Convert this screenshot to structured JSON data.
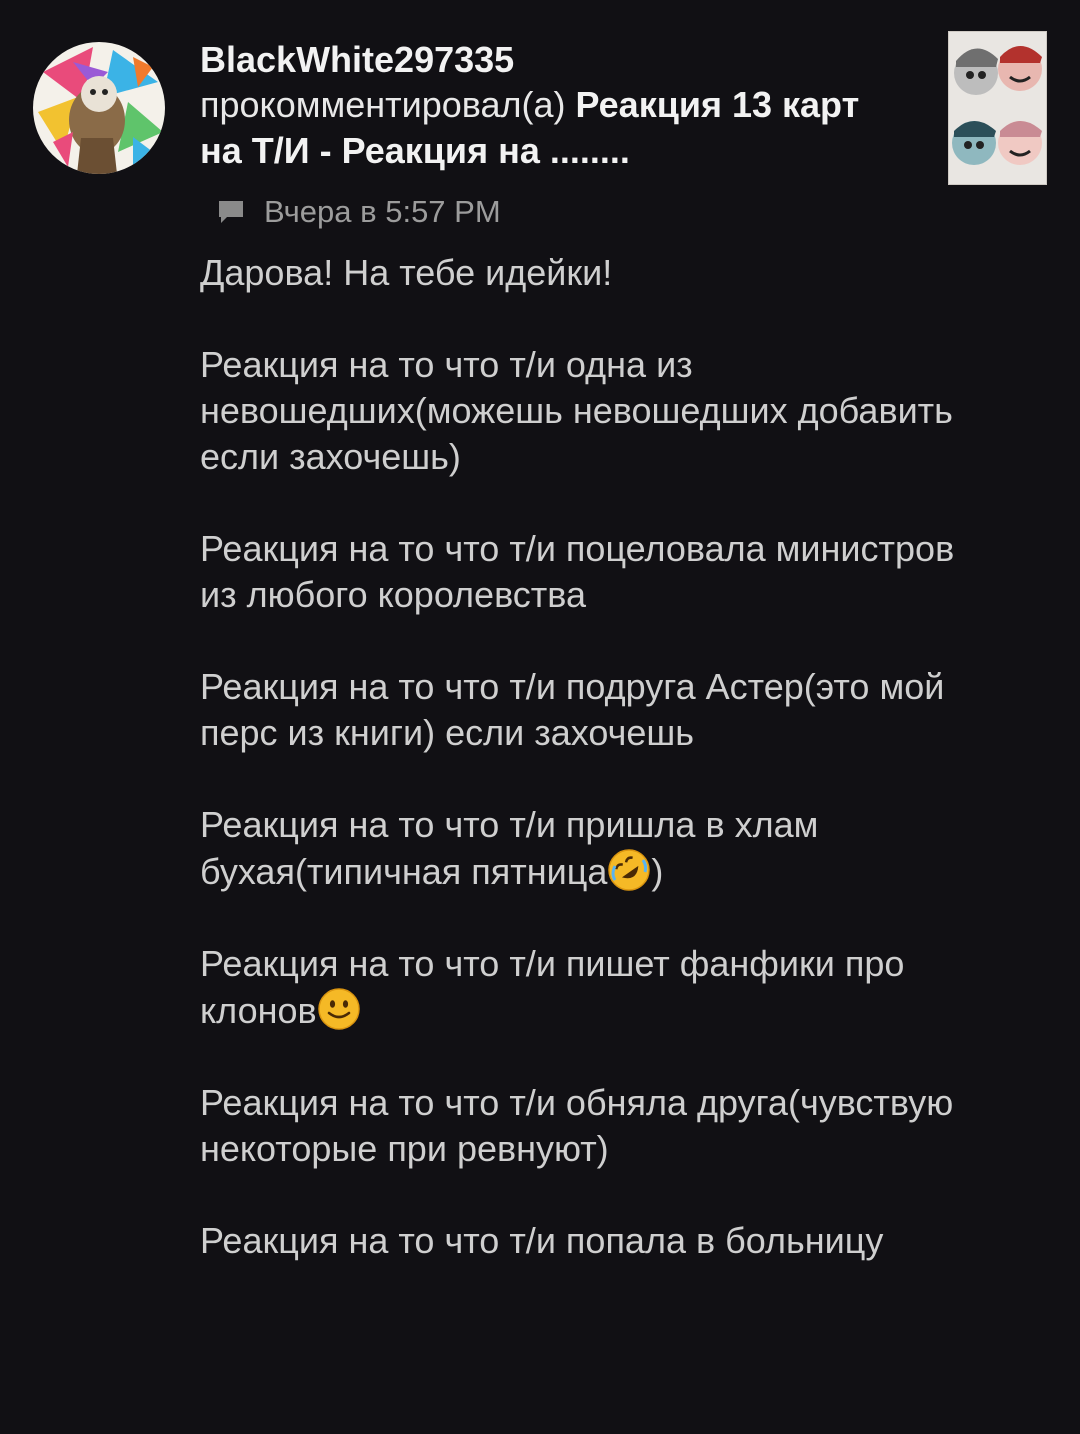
{
  "notification": {
    "username": "BlackWhite297335",
    "action_text": "прокомментировал(а)",
    "post_title": "Реакция 13 карт на Т/И - Реакция на ........",
    "timestamp": "Вчера в 5:57 PM",
    "icons": {
      "timestamp": "comment-bubble-icon"
    },
    "comment": {
      "greeting": "Дарова! На тебе идейки!",
      "ideas": [
        {
          "text": "Реакция на то что т/и одна из невошедших(можешь невошедших добавить если захочешь)"
        },
        {
          "text": "Реакция на то что т/и поцеловала министров из любого королевства"
        },
        {
          "text": "Реакция на то что т/и подруга Астер(это мой перс из книги) если захочешь"
        },
        {
          "text": "Реакция на то что т/и пришла в хлам бухая(типичная пятница",
          "emoji": "rolling-laughing-emoji",
          "after": ")"
        },
        {
          "text": "Реакция на то что т/и пишет фанфики про клонов",
          "emoji": "slight-smile-emoji",
          "after": ""
        },
        {
          "text": "Реакция на то что т/и обняла друга(чувствую некоторые при ревнуют)"
        },
        {
          "text": "Реакция на то что т/и попала в больницу"
        }
      ]
    }
  }
}
